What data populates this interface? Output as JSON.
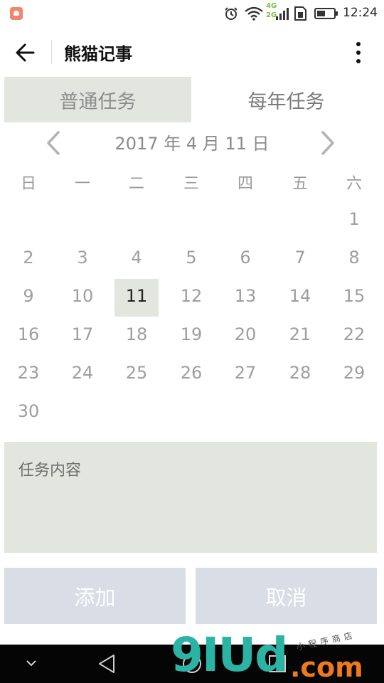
{
  "status_bar": {
    "time": "12:24",
    "network_4g": "4G",
    "network_2g": "2G",
    "icons": [
      "app-notification-icon",
      "alarm-icon",
      "wifi-icon",
      "signal-icon",
      "sim-icon",
      "battery-icon"
    ]
  },
  "app_bar": {
    "title": "熊猫记事",
    "icons": [
      "back-arrow-icon",
      "more-vert-icon"
    ]
  },
  "tabs": {
    "normal": "普通任务",
    "yearly": "每年任务",
    "selected": "normal"
  },
  "calendar": {
    "month_label": "2017 年 4 月 11 日",
    "weekdays": [
      "日",
      "一",
      "二",
      "三",
      "四",
      "五",
      "六"
    ],
    "days": [
      "1",
      "2",
      "3",
      "4",
      "5",
      "6",
      "7",
      "8",
      "9",
      "10",
      "11",
      "12",
      "13",
      "14",
      "15",
      "16",
      "17",
      "18",
      "19",
      "20",
      "21",
      "22",
      "23",
      "24",
      "25",
      "26",
      "27",
      "28",
      "29",
      "30"
    ],
    "selected_day": "11",
    "first_weekday_index": 6
  },
  "task_content": {
    "placeholder": "任务内容"
  },
  "buttons": {
    "add": "添加",
    "cancel": "取消"
  },
  "watermark": {
    "main": "9IUd",
    "suffix": ".com",
    "tagline": "小程序商店"
  },
  "colors": {
    "accent_bg": "#e3e6df",
    "button_bg": "#d8dde6",
    "watermark_teal": "#2bb3a3",
    "watermark_orange": "#ee7a1c"
  }
}
